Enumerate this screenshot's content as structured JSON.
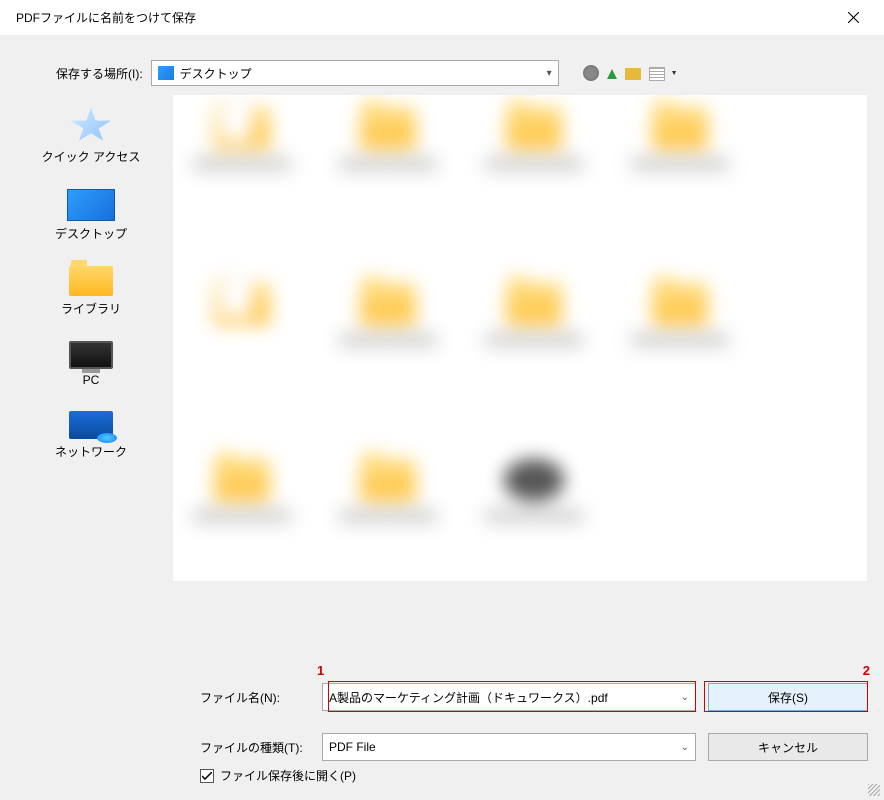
{
  "titlebar": {
    "title": "PDFファイルに名前をつけて保存",
    "close_icon": "×"
  },
  "location": {
    "label": "保存する場所(I):",
    "value": "デスクトップ"
  },
  "sidebar": {
    "items": [
      {
        "label": "クイック アクセス"
      },
      {
        "label": "デスクトップ"
      },
      {
        "label": "ライブラリ"
      },
      {
        "label": "PC"
      },
      {
        "label": "ネットワーク"
      }
    ]
  },
  "form": {
    "filename_label": "ファイル名(N):",
    "filename_value": "A製品のマーケティング計画（ドキュワークス）.pdf",
    "filetype_label": "ファイルの種類(T):",
    "filetype_value": "PDF File",
    "save_label": "保存(S)",
    "cancel_label": "キャンセル"
  },
  "checkbox": {
    "label": "ファイル保存後に開く(P)",
    "checked": true
  },
  "annotations": {
    "one": "1",
    "two": "2"
  }
}
